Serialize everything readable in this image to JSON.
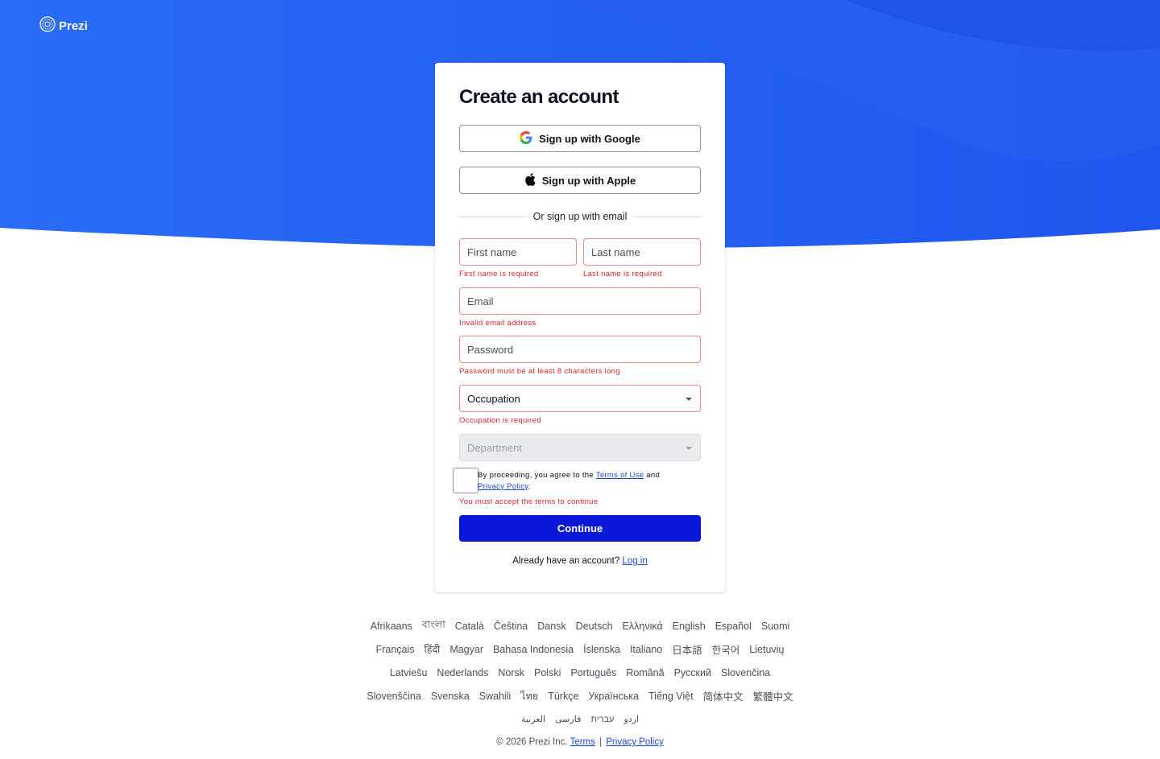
{
  "brand": {
    "name": "Prezi",
    "logo_icon": "prezi-logo-icon"
  },
  "colors": {
    "hero_blue": "#2563f3",
    "primary": "#0a17d6",
    "error": "#d8232a",
    "link": "#1a4bd6"
  },
  "form": {
    "title": "Create an account",
    "google_label": "Sign up with Google",
    "apple_label": "Sign up with Apple",
    "divider_text": "Or sign up with email",
    "first_name": {
      "placeholder": "First name",
      "value": "",
      "error": "First name is required"
    },
    "last_name": {
      "placeholder": "Last name",
      "value": "",
      "error": "Last name is required"
    },
    "email": {
      "placeholder": "Email",
      "value": "",
      "error": "Invalid email address"
    },
    "password": {
      "placeholder": "Password",
      "value": "",
      "error": "Password must be at least 8 characters long"
    },
    "occupation": {
      "label": "Occupation",
      "error": "Occupation is required"
    },
    "department": {
      "label": "Department"
    },
    "terms": {
      "prefix": "By proceeding, you agree to the",
      "terms_link": "Terms of Use",
      "and": "and",
      "privacy_link": "Privacy Policy",
      "suffix": ".",
      "error": "You must accept the terms to continue"
    },
    "continue_label": "Continue",
    "login_prompt": "Already have an account?",
    "login_link": "Log in"
  },
  "languages": [
    [
      "Afrikaans",
      "বাংলা",
      "Català",
      "Čeština",
      "Dansk",
      "Deutsch",
      "Ελληνικά",
      "English",
      "Español",
      "Suomi"
    ],
    [
      "Français",
      "हिंदी",
      "Magyar",
      "Bahasa Indonesia",
      "Íslenska",
      "Italiano",
      "日本語",
      "한국어",
      "Lietuvių"
    ],
    [
      "Latviešu",
      "Nederlands",
      "Norsk",
      "Polski",
      "Português",
      "Română",
      "Русский",
      "Slovenčina"
    ],
    [
      "Slovenščina",
      "Svenska",
      "Swahili",
      "ไทย",
      "Türkçe",
      "Українська",
      "Tiếng Việt",
      "简体中文",
      "繁體中文"
    ],
    [
      "العربية",
      "فارسی",
      "עברית",
      "اردو"
    ]
  ],
  "footer": {
    "copyright": "© 2026 Prezi Inc.",
    "terms": "Terms",
    "separator": "|",
    "privacy": "Privacy Policy"
  }
}
